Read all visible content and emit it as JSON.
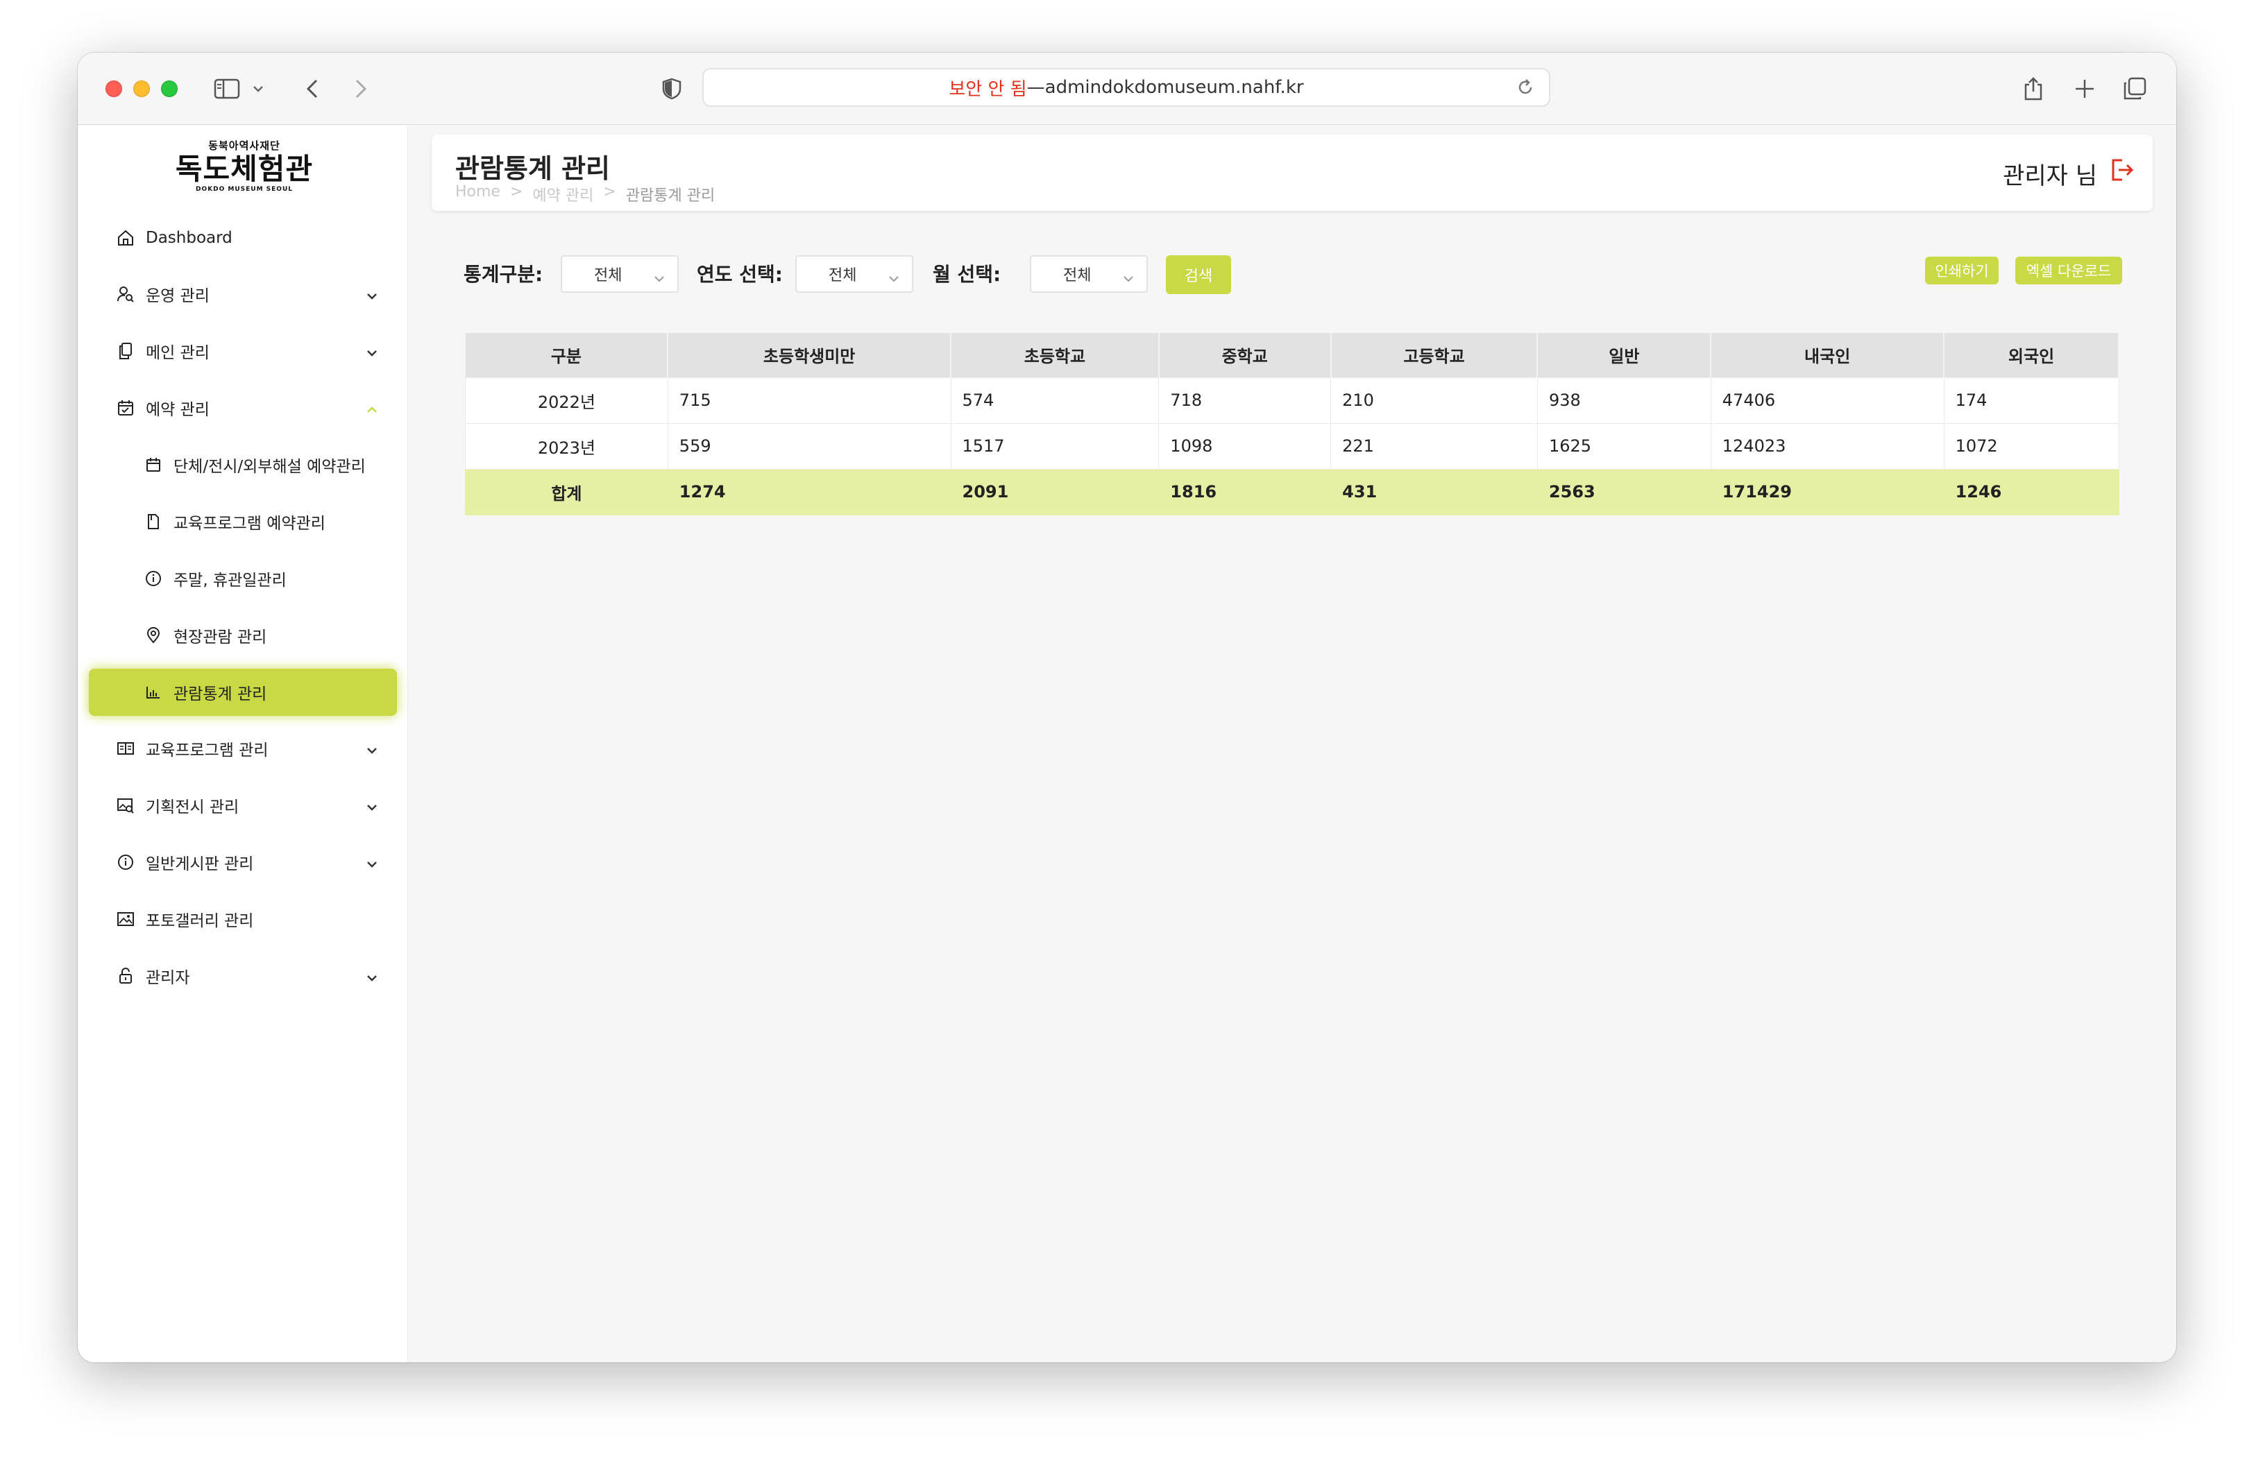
{
  "browser": {
    "address_insecure": "보안 안 됨",
    "address_sep": " — ",
    "address_domain": "admindokdomuseum.nahf.kr"
  },
  "logo": {
    "small": "동북아역사재단",
    "big": "독도체험관",
    "sub": "DOKDO MUSEUM SEOUL"
  },
  "sidebar": {
    "items": [
      {
        "label": "Dashboard",
        "icon": "home-icon"
      },
      {
        "label": "운영 관리",
        "icon": "user-search-icon"
      },
      {
        "label": "메인 관리",
        "icon": "copy-icon"
      },
      {
        "label": "예약 관리",
        "icon": "calendar-icon"
      },
      {
        "label": "단체/전시/외부해설 예약관리",
        "icon": "calendar-icon"
      },
      {
        "label": "교육프로그램 예약관리",
        "icon": "document-icon"
      },
      {
        "label": "주말, 휴관일관리",
        "icon": "info-icon"
      },
      {
        "label": "현장관람 관리",
        "icon": "location-pin-icon"
      },
      {
        "label": "관람통계 관리",
        "icon": "bar-chart-icon"
      },
      {
        "label": "교육프로그램 관리",
        "icon": "book-icon"
      },
      {
        "label": "기획전시 관리",
        "icon": "image-search-icon"
      },
      {
        "label": "일반게시판 관리",
        "icon": "info-icon"
      },
      {
        "label": "포토갤러리 관리",
        "icon": "image-icon"
      },
      {
        "label": "관리자",
        "icon": "lock-icon"
      }
    ]
  },
  "header": {
    "title": "관람통계 관리",
    "breadcrumb": [
      "Home",
      ">",
      "예약 관리",
      ">",
      "관람통계 관리"
    ],
    "admin": "관리자 님"
  },
  "filters": {
    "type_label": "통계구분:",
    "type_value": "전체",
    "year_label": "연도 선택:",
    "year_value": "전체",
    "month_label": "월 선택:",
    "month_value": "전체",
    "search": "검색",
    "print": "인쇄하기",
    "excel": "엑셀 다운로드"
  },
  "colors": {
    "accent": "#c8d945",
    "total_row": "#e7efa5",
    "insecure": "#e0301e",
    "logout": "#e0301e"
  },
  "table": {
    "headers": [
      "구분",
      "초등학생미만",
      "초등학교",
      "중학교",
      "고등학교",
      "일반",
      "내국인",
      "외국인"
    ],
    "rows": [
      [
        "2022년",
        "715",
        "574",
        "718",
        "210",
        "938",
        "47406",
        "174"
      ],
      [
        "2023년",
        "559",
        "1517",
        "1098",
        "221",
        "1625",
        "124023",
        "1072"
      ]
    ],
    "total": [
      "합계",
      "1274",
      "2091",
      "1816",
      "431",
      "2563",
      "171429",
      "1246"
    ]
  }
}
